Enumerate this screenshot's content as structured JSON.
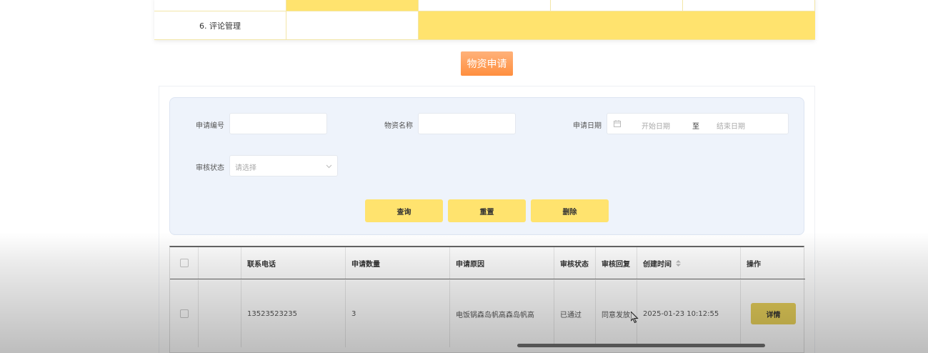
{
  "nav_table": {
    "row1": [
      "",
      "",
      "",
      "",
      ""
    ],
    "row2_first": "6. 评论管理"
  },
  "page_title": "物资申请",
  "search": {
    "apply_no_label": "申请编号",
    "apply_no_value": "",
    "material_name_label": "物资名称",
    "material_name_value": "",
    "apply_date_label": "申请日期",
    "start_placeholder": "开始日期",
    "range_sep": "至",
    "end_placeholder": "结束日期",
    "audit_status_label": "审核状态",
    "audit_status_placeholder": "请选择",
    "query_button": "查询",
    "reset_button": "重置",
    "delete_button": "删除"
  },
  "table": {
    "headers": [
      "联系电话",
      "申请数量",
      "申请原因",
      "审核状态",
      "审核回复",
      "创建时间",
      "操作"
    ],
    "rows": [
      {
        "phone": "13523523235",
        "quantity": "3",
        "reason": "电饭锅森岛帆高森岛帆高",
        "status": "已通过",
        "reply": "同意发放",
        "created": "2025-01-23 10:12:55",
        "action": "详情"
      }
    ]
  },
  "icons": {
    "calendar": "calendar-icon",
    "chevron": "chevron-down-icon",
    "sort": "sort-icon",
    "cursor": "mouse-cursor-icon"
  },
  "colors": {
    "accent_yellow": "#ffe36e",
    "title_orange": "#ff9a4f",
    "search_bg": "#eef3fb"
  }
}
